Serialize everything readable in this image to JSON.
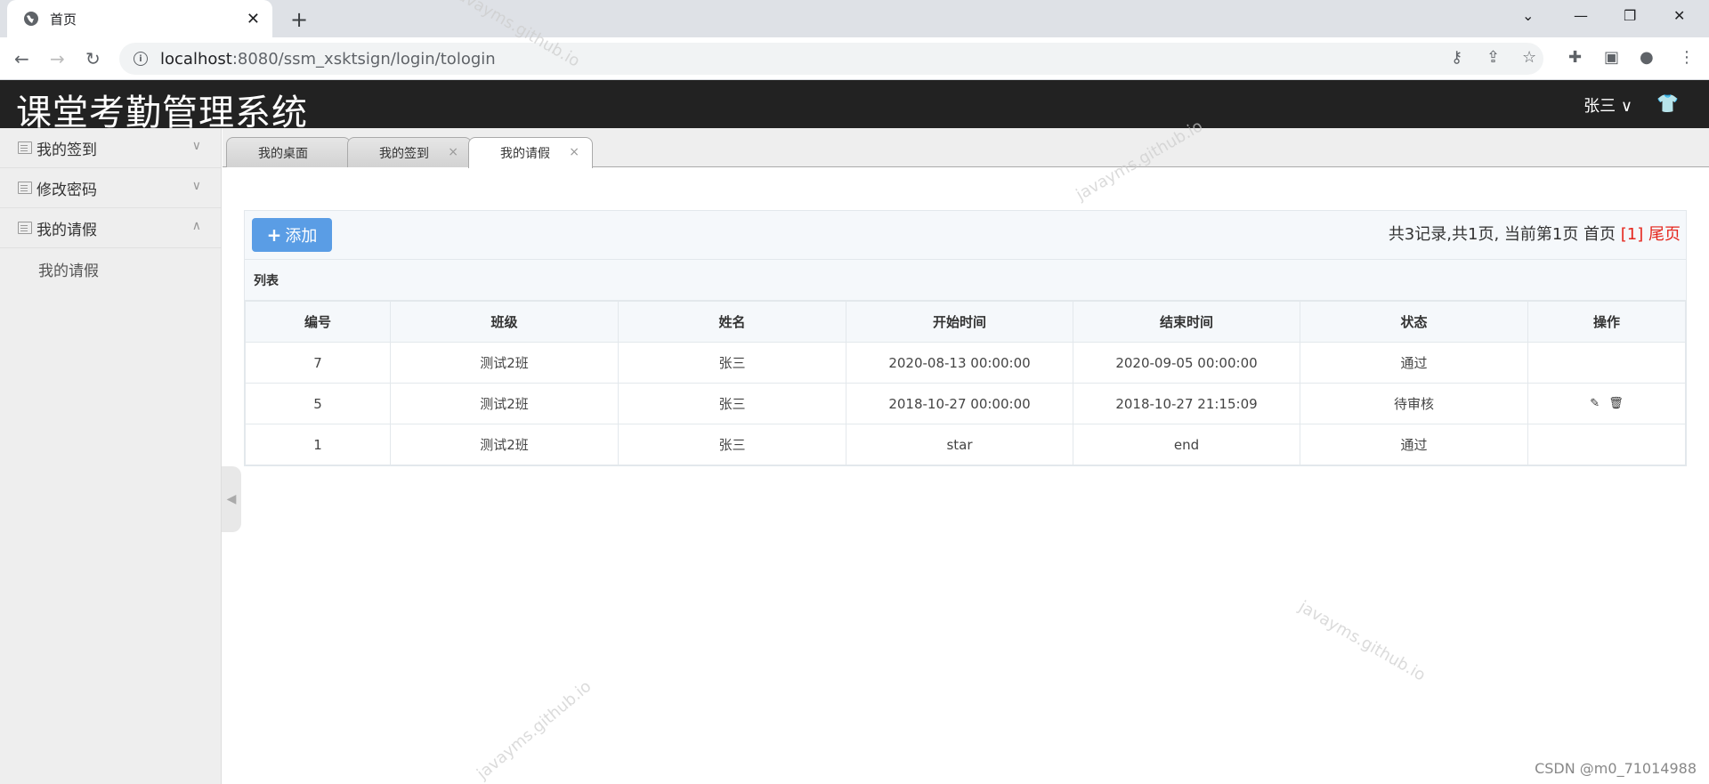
{
  "browser": {
    "tab_title": "首页",
    "tab_close": "✕",
    "new_tab": "+",
    "url_host": "localhost",
    "url_rest": ":8080/ssm_xsktsign/login/tologin"
  },
  "app": {
    "title": "课堂考勤管理系统",
    "user": "张三 ∨",
    "shirt_icon": "👕"
  },
  "sidebar": {
    "items": [
      {
        "label": "我的签到",
        "chev": "∨"
      },
      {
        "label": "修改密码",
        "chev": "∨"
      },
      {
        "label": "我的请假",
        "chev": "∧"
      }
    ],
    "sub": "我的请假"
  },
  "tabs": [
    {
      "label": "我的桌面"
    },
    {
      "label": "我的签到",
      "x": "×"
    },
    {
      "label": "我的请假",
      "x": "×"
    }
  ],
  "toolbar": {
    "add_label": "添加",
    "pager_text": "共3记录,共1页, 当前第1页 首页 ",
    "pager_current": "[1] ",
    "pager_last": "尾页"
  },
  "list_label": "列表",
  "table": {
    "headers": [
      "编号",
      "班级",
      "姓名",
      "开始时间",
      "结束时间",
      "状态",
      "操作"
    ],
    "rows": [
      [
        "7",
        "测试2班",
        "张三",
        "2020-08-13 00:00:00",
        "2020-09-05 00:00:00",
        "通过",
        ""
      ],
      [
        "5",
        "测试2班",
        "张三",
        "2018-10-27 00:00:00",
        "2018-10-27 21:15:09",
        "待审核",
        ""
      ],
      [
        "1",
        "测试2班",
        "张三",
        "star",
        "end",
        "通过",
        ""
      ]
    ]
  },
  "watermark": "javayms.github.io",
  "credit": "CSDN @m0_71014988"
}
